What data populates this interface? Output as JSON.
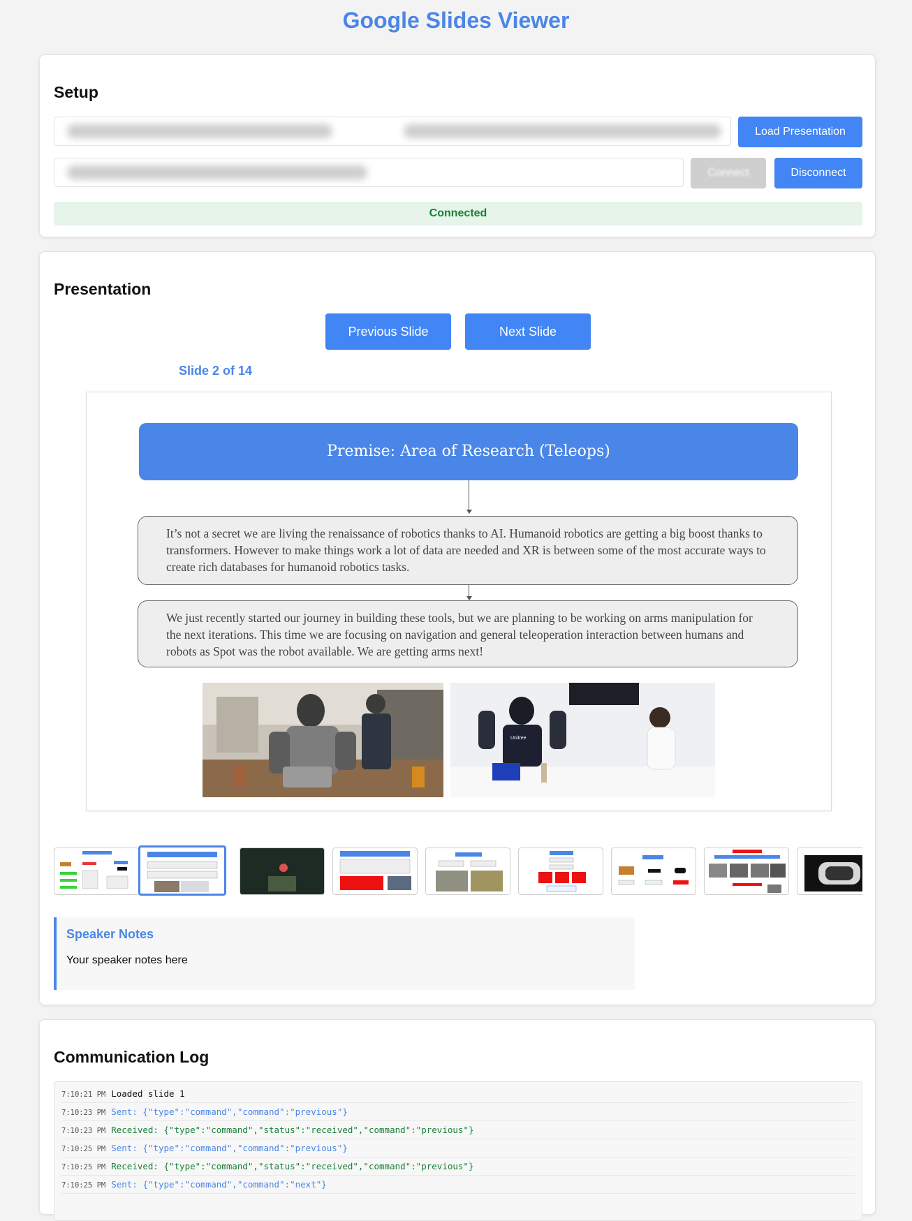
{
  "app": {
    "title": "Google Slides Viewer"
  },
  "colors": {
    "accent": "#4a86e8",
    "success": "#188038",
    "success_bg": "#e6f4ea",
    "button": "#4285f4"
  },
  "setup": {
    "title": "Setup",
    "load_button": "Load Presentation",
    "connect_button": "Connect",
    "disconnect_button": "Disconnect",
    "status": "Connected"
  },
  "presentation": {
    "title": "Presentation",
    "prev_button": "Previous Slide",
    "next_button": "Next Slide",
    "counter": "Slide 2 of 14",
    "slide": {
      "title": "Premise: Area of Research (Teleops)",
      "paragraph1": "It’s not a secret we are living the renaissance of robotics thanks to AI. Humanoid robotics are getting a big boost thanks to transformers. However to make things work a lot of data are needed and XR is between some of the most accurate ways to create rich databases for humanoid robotics tasks.",
      "paragraph2": "We just recently started our journey in building these tools, but we are planning to be working on arms manipulation for the next iterations. This time we are focusing on navigation and general teleoperation interaction between humans and robots as Spot was the robot available. We are getting arms next!",
      "photo2_brand": "Unitree"
    },
    "thumbnail_count": 9,
    "active_thumbnail": 2
  },
  "notes": {
    "title": "Speaker Notes",
    "text": "Your speaker notes here"
  },
  "log": {
    "title": "Communication Log",
    "entries": [
      {
        "time": "7:10:21 PM",
        "message": "Loaded slide 1",
        "type": "info"
      },
      {
        "time": "7:10:23 PM",
        "message": "Sent: {\"type\":\"command\",\"command\":\"previous\"}",
        "type": "sent"
      },
      {
        "time": "7:10:23 PM",
        "message": "Received: {\"type\":\"command\",\"status\":\"received\",\"command\":\"previous\"}",
        "type": "received"
      },
      {
        "time": "7:10:25 PM",
        "message": "Sent: {\"type\":\"command\",\"command\":\"previous\"}",
        "type": "sent"
      },
      {
        "time": "7:10:25 PM",
        "message": "Received: {\"type\":\"command\",\"status\":\"received\",\"command\":\"previous\"}",
        "type": "received"
      },
      {
        "time": "7:10:25 PM",
        "message": "Sent: {\"type\":\"command\",\"command\":\"next\"}",
        "type": "sent"
      }
    ]
  }
}
